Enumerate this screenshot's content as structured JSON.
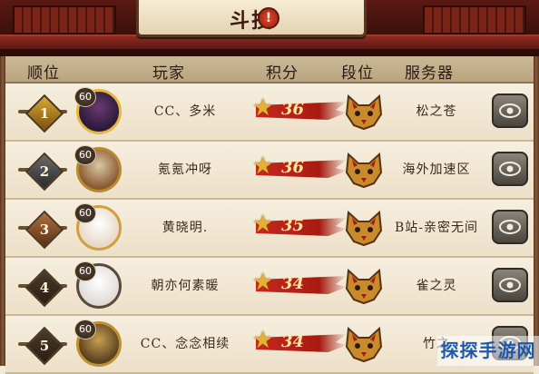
{
  "header": {
    "title": "斗技",
    "alert_icon": "exclamation-icon",
    "alert_glyph": "!"
  },
  "columns": {
    "rank": "顺位",
    "player": "玩家",
    "score": "积分",
    "tier": "段位",
    "server": "服务器"
  },
  "rows": [
    {
      "rank": "1",
      "level": "60",
      "player": "CC、多米",
      "score": "36",
      "tier_icon": "fox-mask-icon",
      "server": "松之苍",
      "view_icon": "eye-icon"
    },
    {
      "rank": "2",
      "level": "60",
      "player": "氪氪冲呀",
      "score": "36",
      "tier_icon": "fox-mask-icon",
      "server": "海外加速区",
      "view_icon": "eye-icon"
    },
    {
      "rank": "3",
      "level": "60",
      "player": "黄晓明.",
      "score": "35",
      "tier_icon": "fox-mask-icon",
      "server": "B站-亲密无间",
      "view_icon": "eye-icon"
    },
    {
      "rank": "4",
      "level": "60",
      "player": "朝亦何素暖",
      "score": "34",
      "tier_icon": "fox-mask-icon",
      "server": "雀之灵",
      "view_icon": "eye-icon"
    },
    {
      "rank": "5",
      "level": "60",
      "player": "CC、念念相续",
      "score": "34",
      "tier_icon": "fox-mask-icon",
      "server": "竹之",
      "view_icon": "eye-icon"
    }
  ],
  "watermark": "探探手游网",
  "colors": {
    "accent_red": "#c8281c",
    "gold": "#e8b030",
    "parchment": "#f2e8d6"
  }
}
